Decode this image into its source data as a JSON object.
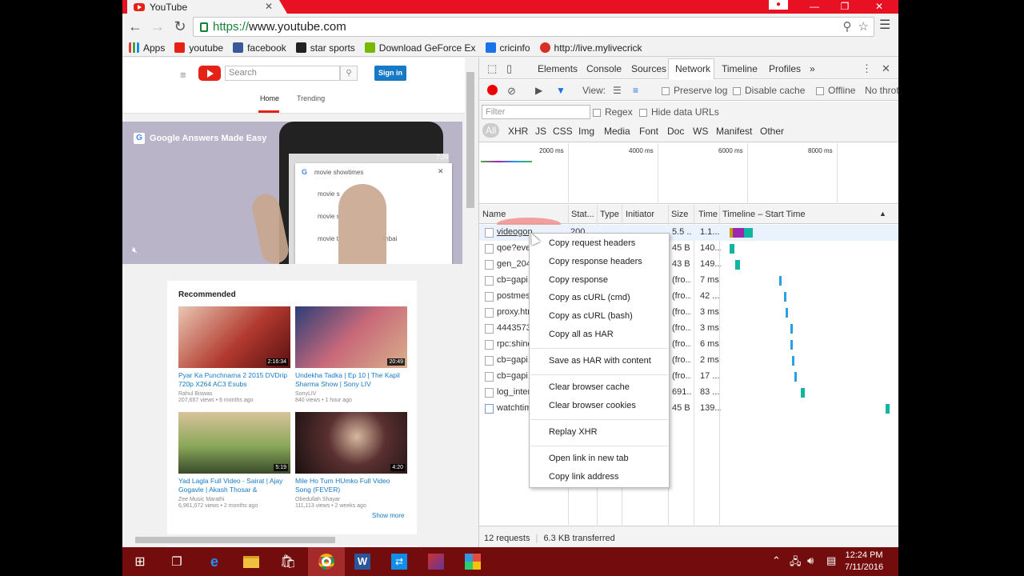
{
  "browser": {
    "tab_title": "YouTube",
    "url_secure": "https://",
    "url_host": "www.youtube.com",
    "bookmarks": [
      {
        "label": "Apps",
        "color": "#4285f4"
      },
      {
        "label": "youtube",
        "color": "#e62117"
      },
      {
        "label": "facebook",
        "color": "#3b5998"
      },
      {
        "label": "star sports",
        "color": "#222222"
      },
      {
        "label": "Download GeForce Ex",
        "color": "#76b900"
      },
      {
        "label": "cricinfo",
        "color": "#1a73e8"
      },
      {
        "label": "http://live.mylivecrick",
        "color": "#d93025"
      }
    ]
  },
  "youtube": {
    "search_placeholder": "Search",
    "signin": "Sign in",
    "tabs": {
      "home": "Home",
      "trending": "Trending"
    },
    "video_title": "Google Answers Made Easy",
    "phone_search": "movie showtimes",
    "phone_rows": [
      "movie s",
      "movie s",
      "movie t",
      "mbai"
    ],
    "phone_time": "7:39",
    "recommended": "Recommended",
    "show_more": "Show more",
    "videos": [
      {
        "title": "Pyar Ka Punchnama 2 2015 DVDrip 720p X264 AC3 Esubs",
        "channel": "Rahul Biswas",
        "meta": "207,657 views • 6 months ago",
        "duration": "2:16:34",
        "color": "#a3201c"
      },
      {
        "title": "Undekha Tadka | Ep 10 | The Kapil Sharma Show | Sony LIV",
        "channel": "SonyLIV",
        "meta": "840 views • 1 hour ago",
        "duration": "20:49",
        "color": "#3a4a8a"
      },
      {
        "title": "Yad Lagla Full Video - Sairat | Ajay Gogavle | Akash Thosar &",
        "channel": "Zee Music Marathi",
        "meta": "6,961,072 views • 2 months ago",
        "duration": "5:19",
        "color": "#7a9a4a"
      },
      {
        "title": "Mile Ho Tum HUmko Full Video Song (FEVER)",
        "channel": "Obedullah Shayar",
        "meta": "111,113 views • 2 weeks ago",
        "duration": "4:20",
        "color": "#3a2a2a"
      }
    ]
  },
  "devtools": {
    "tabs": [
      "Elements",
      "Console",
      "Sources",
      "Network",
      "Timeline",
      "Profiles"
    ],
    "more": "»",
    "toolbar": {
      "view": "View:",
      "preserve_log": "Preserve log",
      "disable_cache": "Disable cache",
      "offline": "Offline",
      "throttle": "No throt"
    },
    "filter_placeholder": "Filter",
    "regex": "Regex",
    "hide_data_urls": "Hide data URLs",
    "types": [
      "All",
      "XHR",
      "JS",
      "CSS",
      "Img",
      "Media",
      "Font",
      "Doc",
      "WS",
      "Manifest",
      "Other"
    ],
    "overview_ticks": [
      "2000 ms",
      "4000 ms",
      "6000 ms",
      "8000 ms"
    ],
    "columns": {
      "name": "Name",
      "status": "Stat...",
      "type": "Type",
      "initiator": "Initiator",
      "size": "Size",
      "time": "Time",
      "timeline": "Timeline – Start Time"
    },
    "rows": [
      {
        "name": "videogon",
        "status": "200",
        "size": "5.5 ...",
        "time": "1.1...",
        "bar_color": "#12b5a0"
      },
      {
        "name": "qoe?even",
        "status": "",
        "size": "45 B",
        "time": "140...",
        "bar_color": "#12b5a0"
      },
      {
        "name": "gen_2041",
        "status": "",
        "size": "43 B",
        "time": "149...",
        "bar_color": "#12b5a0"
      },
      {
        "name": "cb=gapi.",
        "status": "",
        "size": "(fro...",
        "time": "7 ms",
        "bar_color": "#2aa1e0"
      },
      {
        "name": "postmess",
        "status": "",
        "size": "(fro...",
        "time": "42 ...",
        "bar_color": "#2aa1e0"
      },
      {
        "name": "proxy.htm",
        "status": "",
        "size": "(fro...",
        "time": "3 ms",
        "bar_color": "#2aa1e0"
      },
      {
        "name": "44435735",
        "status": "",
        "size": "(fro...",
        "time": "3 ms",
        "bar_color": "#2aa1e0"
      },
      {
        "name": "rpc:shind",
        "status": "",
        "size": "(fro...",
        "time": "6 ms",
        "bar_color": "#2aa1e0"
      },
      {
        "name": "cb=gapi.",
        "status": "",
        "size": "(fro...",
        "time": "2 ms",
        "bar_color": "#2aa1e0"
      },
      {
        "name": "cb=gapi.",
        "status": "",
        "size": "(fro...",
        "time": "17 ...",
        "bar_color": "#2aa1e0"
      },
      {
        "name": "log_inter",
        "status": "",
        "size": "691...",
        "time": "83 ...",
        "bar_color": "#12b5a0"
      },
      {
        "name": "watchtim",
        "status": "",
        "size": "45 B",
        "time": "139...",
        "bar_color": "#12b5a0"
      }
    ],
    "status_requests": "12 requests",
    "status_transferred": "6.3 KB transferred"
  },
  "context_menu": {
    "items": [
      "Copy request headers",
      "Copy response headers",
      "Copy response",
      "Copy as cURL (cmd)",
      "Copy as cURL (bash)",
      "Copy all as HAR",
      "Save as HAR with content",
      "Clear browser cache",
      "Clear browser cookies",
      "Replay XHR",
      "Open link in new tab",
      "Copy link address"
    ]
  },
  "taskbar": {
    "time": "12:24 PM",
    "date": "7/11/2016"
  }
}
